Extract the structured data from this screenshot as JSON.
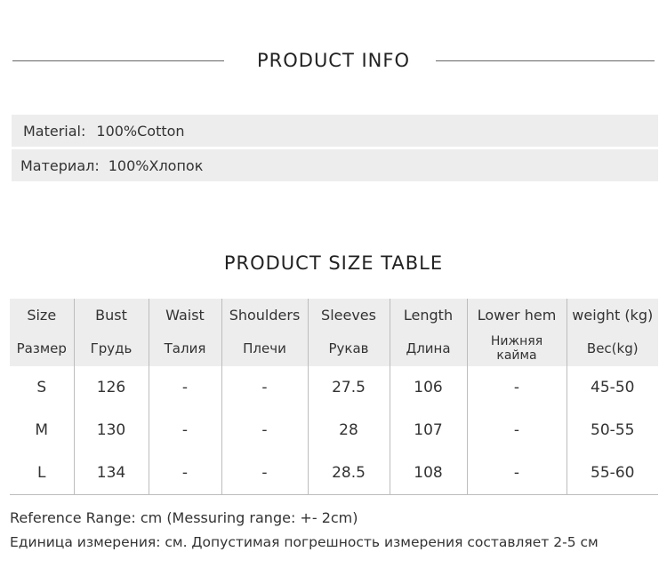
{
  "product_info": {
    "title": "PRODUCT INFO",
    "rows": [
      {
        "label": "Material:",
        "value": "100%Cotton"
      },
      {
        "label": "Материал:",
        "value": "100%Хлопок"
      }
    ]
  },
  "size_table": {
    "title": "PRODUCT SIZE TABLE",
    "headers_en": [
      "Size",
      "Bust",
      "Waist",
      "Shoulders",
      "Sleeves",
      "Length",
      "Lower hem",
      "weight (kg)"
    ],
    "headers_ru": [
      "Размер",
      "Грудь",
      "Талия",
      "Плечи",
      "Рукав",
      "Длина",
      "Нижняя кайма",
      "Вес(kg)"
    ],
    "rows": [
      [
        "S",
        "126",
        "-",
        "-",
        "27.5",
        "106",
        "-",
        "45-50"
      ],
      [
        "M",
        "130",
        "-",
        "-",
        "28",
        "107",
        "-",
        "50-55"
      ],
      [
        "L",
        "134",
        "-",
        "-",
        "28.5",
        "108",
        "-",
        "55-60"
      ]
    ]
  },
  "notes": {
    "reference_en": "Reference Range: cm (Messuring range: +- 2cm)",
    "reference_ru": "Единица измерения: см. Допустимая погрешность измерения составляет 2-5 см"
  }
}
